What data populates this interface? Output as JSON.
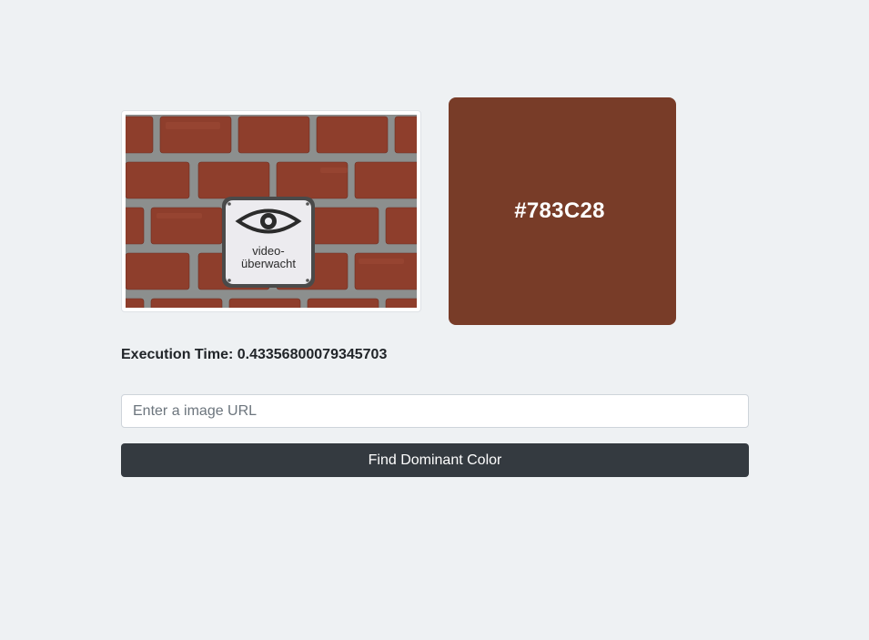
{
  "preview": {
    "sign_line_1": "video-",
    "sign_line_2": "überwacht"
  },
  "result": {
    "hex_label": "#783C28",
    "color": "#783C28"
  },
  "execution": {
    "label": "Execution Time: 0.43356800079345703"
  },
  "form": {
    "url_value": "",
    "url_placeholder": "Enter a image URL",
    "submit_label": "Find Dominant Color"
  },
  "colors": {
    "page_background": "#eef1f3",
    "button_background": "#343a40",
    "brick": "#8e3e2c",
    "mortar": "#8c8f8e"
  },
  "icons": {
    "sign_symbol": "eye-icon"
  }
}
